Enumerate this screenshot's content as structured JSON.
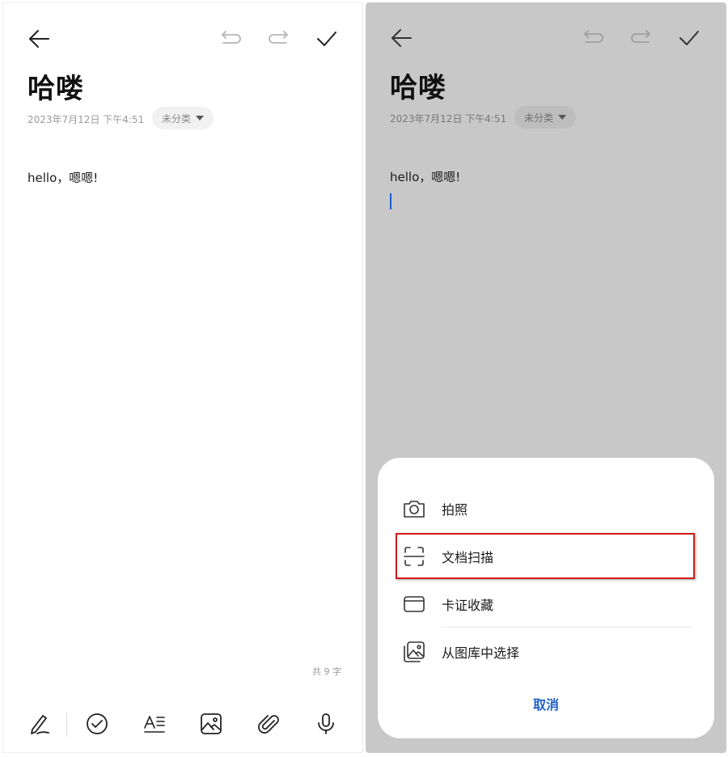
{
  "note": {
    "title": "哈喽",
    "date": "2023年7月12日 下午4:51",
    "category": "未分类",
    "body": "hello，嗯嗯!",
    "word_count": "共 9 字"
  },
  "header_icons": [
    "back-arrow-icon",
    "undo-icon",
    "redo-icon",
    "confirm-check-icon"
  ],
  "toolbar_icons": [
    "handwriting-pen-icon",
    "checklist-icon",
    "text-format-icon",
    "image-icon",
    "attachment-paperclip-icon",
    "microphone-icon"
  ],
  "sheet": {
    "items": [
      {
        "label": "拍照",
        "icon": "camera-icon"
      },
      {
        "label": "文档扫描",
        "icon": "document-scan-icon"
      },
      {
        "label": "卡证收藏",
        "icon": "id-card-icon"
      },
      {
        "label": "从图库中选择",
        "icon": "gallery-icon"
      }
    ],
    "cancel": "取消"
  },
  "colors": {
    "accent_blue": "#2060c8",
    "highlight_red": "#d21a1a",
    "overlay_gray": "#c8c8c8"
  }
}
